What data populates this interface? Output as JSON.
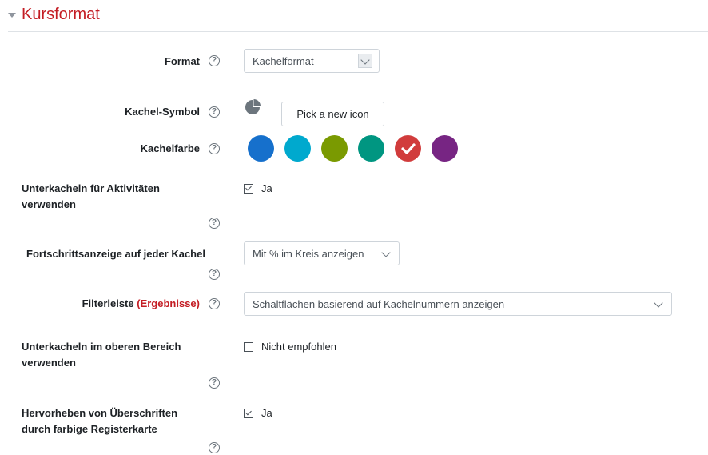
{
  "section": {
    "title": "Kursformat"
  },
  "fields": {
    "format": {
      "label": "Format",
      "value": "Kachelformat"
    },
    "kachel_symbol": {
      "label": "Kachel-Symbol",
      "button": "Pick a new icon",
      "icon": "pie-chart-icon"
    },
    "kachelfarbe": {
      "label": "Kachelfarbe",
      "swatches": [
        {
          "color": "#1670cc",
          "selected": false
        },
        {
          "color": "#00a9ce",
          "selected": false
        },
        {
          "color": "#7a9a01",
          "selected": false
        },
        {
          "color": "#009681",
          "selected": false
        },
        {
          "color": "#d13c3c",
          "selected": true
        },
        {
          "color": "#772583",
          "selected": false
        }
      ]
    },
    "unterkacheln_aktivitaeten": {
      "label_line1": "Unterkacheln für Aktivitäten",
      "label_line2": "verwenden",
      "checkbox_label": "Ja",
      "checked": true
    },
    "fortschritt": {
      "label": "Fortschrittsanzeige auf jeder Kachel",
      "value": "Mit % im Kreis anzeigen"
    },
    "filterleiste": {
      "label": "Filterleiste",
      "label_highlight": "(Ergebnisse)",
      "value": "Schaltflächen basierend auf Kachelnummern anzeigen"
    },
    "unterkacheln_oben": {
      "label_line1": "Unterkacheln im oberen Bereich",
      "label_line2": "verwenden",
      "checkbox_label": "Nicht empfohlen",
      "checked": false
    },
    "hervorheben": {
      "label_line1": "Hervorheben von Überschriften",
      "label_line2": "durch farbige Registerkarte",
      "checkbox_label": "Ja",
      "checked": true
    }
  },
  "help_glyph": "?",
  "colors": {
    "accent": "#c41e25",
    "border": "#ced4da",
    "text": "#1d2125"
  }
}
